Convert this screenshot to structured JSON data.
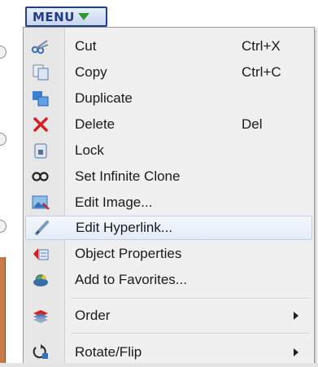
{
  "menu_button": {
    "label": "MENU",
    "arrow_icon": "triangle-down-icon"
  },
  "items": [
    {
      "id": "cut",
      "label": "Cut",
      "shortcut": "Ctrl+X",
      "icon": "scissors-icon"
    },
    {
      "id": "copy",
      "label": "Copy",
      "shortcut": "Ctrl+C",
      "icon": "copy-icon"
    },
    {
      "id": "duplicate",
      "label": "Duplicate",
      "shortcut": "",
      "icon": "duplicate-icon"
    },
    {
      "id": "delete",
      "label": "Delete",
      "shortcut": "Del",
      "icon": "delete-x-icon"
    },
    {
      "id": "lock",
      "label": "Lock",
      "shortcut": "",
      "icon": "lock-icon"
    },
    {
      "id": "set-infinite-clone",
      "label": "Set Infinite Clone",
      "shortcut": "",
      "icon": "infinity-icon"
    },
    {
      "id": "edit-image",
      "label": "Edit Image...",
      "shortcut": "",
      "icon": "image-icon"
    },
    {
      "id": "edit-hyperlink",
      "label": "Edit Hyperlink...",
      "shortcut": "",
      "icon": "pen-icon",
      "highlighted": true
    },
    {
      "id": "object-properties",
      "label": "Object Properties",
      "shortcut": "",
      "icon": "properties-icon"
    },
    {
      "id": "add-to-favorites",
      "label": "Add to Favorites...",
      "shortcut": "",
      "icon": "favorites-icon"
    },
    {
      "id": "order",
      "label": "Order",
      "shortcut": "",
      "icon": "order-icon",
      "submenu": true
    },
    {
      "id": "rotate-flip",
      "label": "Rotate/Flip",
      "shortcut": "",
      "icon": "rotate-icon",
      "submenu": true
    }
  ],
  "colors": {
    "menu_button_text": "#1f3d86",
    "menu_arrow": "#2e9b2e",
    "delete_icon": "#d42020",
    "highlight_border": "#bcd0ea"
  }
}
